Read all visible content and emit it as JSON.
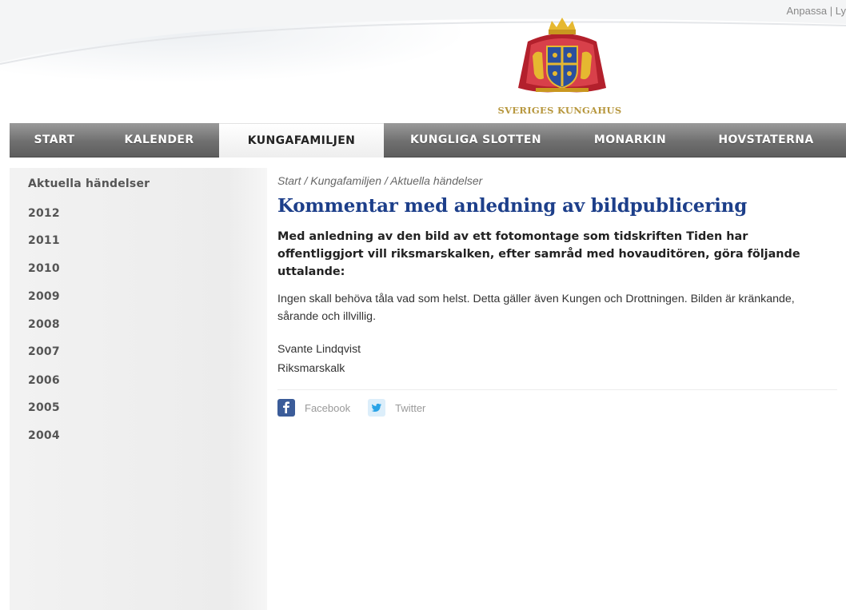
{
  "header": {
    "top_links": [
      "Anpassa",
      "|",
      "Ly"
    ],
    "logo_text": "SVERIGES KUNGAHUS"
  },
  "nav": {
    "items": [
      {
        "label": "START"
      },
      {
        "label": "KALENDER"
      },
      {
        "label": "KUNGAFAMILJEN",
        "active": true
      },
      {
        "label": "KUNGLIGA SLOTTEN"
      },
      {
        "label": "MONARKIN"
      },
      {
        "label": "HOVSTATERNA"
      }
    ]
  },
  "sidebar": {
    "items": [
      {
        "label": "Aktuella händelser"
      },
      {
        "label": "2012"
      },
      {
        "label": "2011"
      },
      {
        "label": "2010"
      },
      {
        "label": "2009"
      },
      {
        "label": "2008"
      },
      {
        "label": "2007"
      },
      {
        "label": "2006"
      },
      {
        "label": "2005"
      },
      {
        "label": "2004"
      }
    ]
  },
  "main": {
    "breadcrumb": [
      "Start",
      " / ",
      "Kungafamiljen",
      " / ",
      "Aktuella händelser"
    ],
    "title": "Kommentar med anledning av bildpublicering",
    "lead": "Med anledning av den bild av ett fotomontage som tidskriften Tiden har offentliggjort vill riksmarskalken, efter samråd med hovauditören, göra följande uttalande:",
    "body": "Ingen skall behöva tåla vad som helst. Detta gäller även Kungen och Drottningen. Bilden är kränkande, sårande och illvillig.",
    "signature_name": "Svante Lindqvist",
    "signature_role": "Riksmarskalk",
    "share": {
      "facebook_label": "Facebook",
      "twitter_label": "Twitter"
    }
  },
  "colors": {
    "title_blue": "#1d3f8a",
    "nav_gray": "#6f6f6f",
    "logo_gold": "#b7973e",
    "facebook_blue": "#3b5c99"
  }
}
